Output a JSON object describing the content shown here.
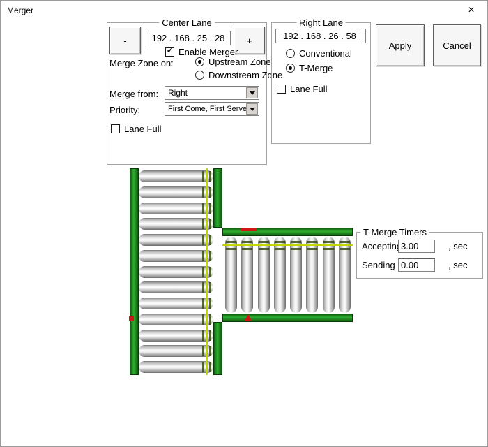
{
  "window": {
    "title": "Merger",
    "close_glyph": "×"
  },
  "center_lane": {
    "title": "Center Lane",
    "decrement_label": "-",
    "increment_label": "+",
    "ip_address": "192 . 168 . 25 . 28",
    "enable_merger": {
      "label": "Enable Merger",
      "checked": true
    },
    "merge_zone_label": "Merge Zone on:",
    "merge_zone_options": [
      {
        "label": "Upstream Zone",
        "selected": true
      },
      {
        "label": "Downstream Zone",
        "selected": false
      }
    ],
    "merge_from_label": "Merge from:",
    "merge_from_value": "Right",
    "priority_label": "Priority:",
    "priority_value": "First Come, First Served",
    "lane_full": {
      "label": "Lane Full",
      "checked": false
    }
  },
  "right_lane": {
    "title": "Right Lane",
    "ip_address": "192 . 168 . 26 . 58",
    "mode_options": [
      {
        "label": "Conventional",
        "selected": false
      },
      {
        "label": "T-Merge",
        "selected": true
      }
    ],
    "lane_full": {
      "label": "Lane Full",
      "checked": false
    }
  },
  "actions": {
    "apply_label": "Apply",
    "cancel_label": "Cancel"
  },
  "tmerge_timers": {
    "title": "T-Merge Timers",
    "accepting_label": "Accepting",
    "accepting_value": "3.00",
    "sending_label": "Sending",
    "sending_value": "0.00",
    "unit_suffix": ", sec"
  },
  "conveyor": {
    "vertical_roller_count": 13,
    "horizontal_roller_count": 8,
    "rail_color": "#2fae2f",
    "sensor_line_color": "#c2d500",
    "marker_color": "#cf1616",
    "roller_color": "#e0e0e0"
  }
}
